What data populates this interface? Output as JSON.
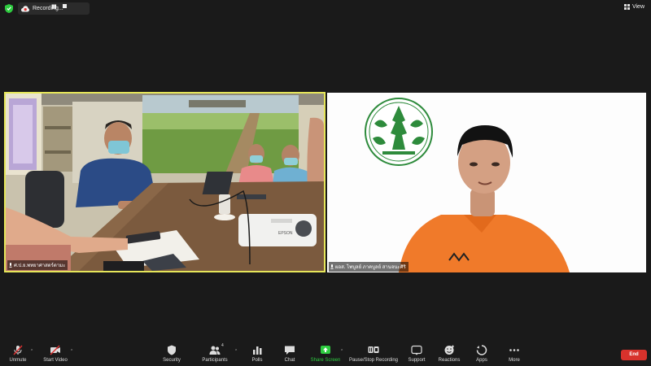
{
  "topbar": {
    "recording_label": "Recording...",
    "view_label": "View"
  },
  "participants": [
    {
      "name_tag": "ศ.ป.ย.พทยาศาสตร์ตามะ"
    },
    {
      "name_tag": "ผอส. ไพบูลย์ ภาคบูลย์ สานจนะศิริ"
    }
  ],
  "toolbar": {
    "unmute_label": "Unmute",
    "start_video_label": "Start Video",
    "security_label": "Security",
    "participants_label": "Participants",
    "participants_count": "4",
    "polls_label": "Polls",
    "chat_label": "Chat",
    "share_screen_label": "Share Screen",
    "pause_stop_label": "Pause/Stop Recording",
    "support_label": "Support",
    "reactions_label": "Reactions",
    "apps_label": "Apps",
    "more_label": "More",
    "end_label": "End",
    "accent_green": "#2ecc40",
    "end_red": "#d8322c"
  },
  "projector_label": "EPSON"
}
